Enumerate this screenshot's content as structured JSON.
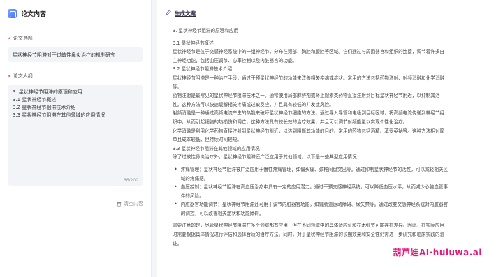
{
  "brand": {
    "title": "论文内容"
  },
  "form": {
    "title_label": "论文选题",
    "title_value": "星状神经节阻滞对于过敏性鼻炎治疗的机制研究",
    "outline_label": "论文大纲",
    "outline_lines": [
      "3. 星状神经节阻滞的原理和应用",
      "3.1 星状神经节概述",
      "3.2 星状神经节阻滞技术介绍",
      "3.3 星状神经节阻滞在其他领域的应用情况"
    ],
    "counter": "66/200",
    "clear_label": "清空内容"
  },
  "output": {
    "header": "生成文案",
    "paragraphs": [
      "3. 星状神经节阻滞的原理和应用",
      "",
      "3.1 星状神经节概述",
      "星状神经节是位于交感神经系统中的一组神经节，分布在颈部、胸腔和腹腔等区域。它们通过与周围器官和组织的连接，调节着许多自",
      "主神经功能，包括血压调节、心率控制以及内脏器官的功能。",
      "3.2 星状神经节阻滞技术介绍",
      "星状神经节阻滞是一种治疗手段，通过干预星状神经节的功能来改善相关疾病或症状。常用的方法包括药物注射、射频消融和化学消融",
      "等。",
      "药物注射是最常见的星状神经节阻滞技术之一。通常使用局部麻醉剂或肾上腺素类药物直接注射到目标星状神经节附近，以抑制其活",
      "性。这种方法可以快速缓解相关疼痛或过敏反应，并且具有较低的并发症风险。",
      "射频消融是一种通过高频电流产生的热能来破坏星状神经节细胞的方法。通过导入导管和电极到目标区域，将高频电流传递到神经节组",
      "织中，从而引起细胞的热损伤和凋亡。这种方法具有较长效的治疗效果，并且可以调节射频能量以实现个性化治疗。",
      "化学消融是利用化学药物直接注射到星状神经节附近，以达到阻断其功能的目的。常用的药物包括酒精、苯妥英钠等。这种方法相对简",
      "单且成本较低，但持续时间较短。",
      "3.3 星状神经节阻滞在其他领域的应用情况",
      "除了过敏性鼻炎治疗外，星状神经节阻滞还广泛应用于其他领域。以下是一些典型应用情况："
    ],
    "bullets": [
      [
        "疼痛管理：星状神经节阻滞被广泛应用于慢性疼痛管理，如偏头痛、颈椎间盘突出等。通过抑制星状神经节的活性，可以减轻相关区",
        "域的疼痛感。"
      ],
      [
        "血压控制：星状神经节阻滞在高血压治疗中具有一定的应用潜力。通过干预交感神经系统，可以降低血压水平，从而减少心脑血管事",
        "件的风险。"
      ],
      [
        "内脏器官功能调节：星状神经节阻滞还可用于调节内脏器官功能，如胃肠道运动障碍、尿失禁等。通过改变交感神经系统对内脏器官",
        "的调控，可以改善相关症状和功能障碍。"
      ]
    ],
    "closing": [
      "需要注意的是，尽管星状神经节阻滞在多个领域都有应用，但在不同领域中的具体适应证和技术细节可能存在差异。因此，在实际应用",
      "时需要根据具体情况进行评估和选择合适的治疗方法。同时，对于星状神经节阻滞的长期效果和安全性仍需进一步研究和临床实践的验",
      "证。"
    ],
    "watermark": "葫芦娃AI·huluwa.ai"
  }
}
